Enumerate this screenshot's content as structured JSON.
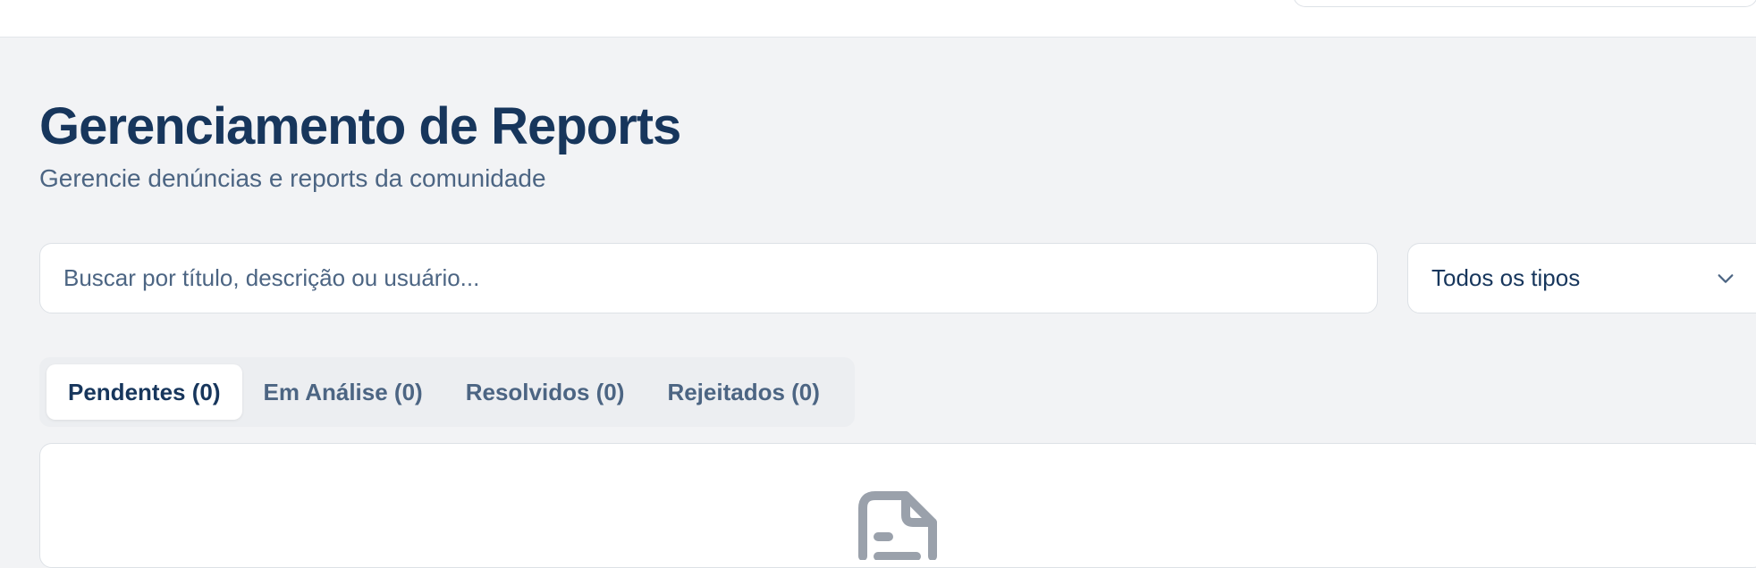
{
  "header": {
    "title": "Gerenciamento de Reports",
    "subtitle": "Gerencie denúncias e reports da comunidade"
  },
  "filters": {
    "search_placeholder": "Buscar por título, descrição ou usuário...",
    "type_select_value": "Todos os tipos"
  },
  "tabs": [
    {
      "label": "Pendentes (0)",
      "active": true
    },
    {
      "label": "Em Análise (0)",
      "active": false
    },
    {
      "label": "Resolvidos (0)",
      "active": false
    },
    {
      "label": "Rejeitados (0)",
      "active": false
    }
  ],
  "empty_state": {
    "icon": "document-icon"
  },
  "colors": {
    "primary_text": "#17365c",
    "secondary_text": "#4c6583",
    "background": "#f2f3f5",
    "icon_gray": "#9aa1ab"
  }
}
